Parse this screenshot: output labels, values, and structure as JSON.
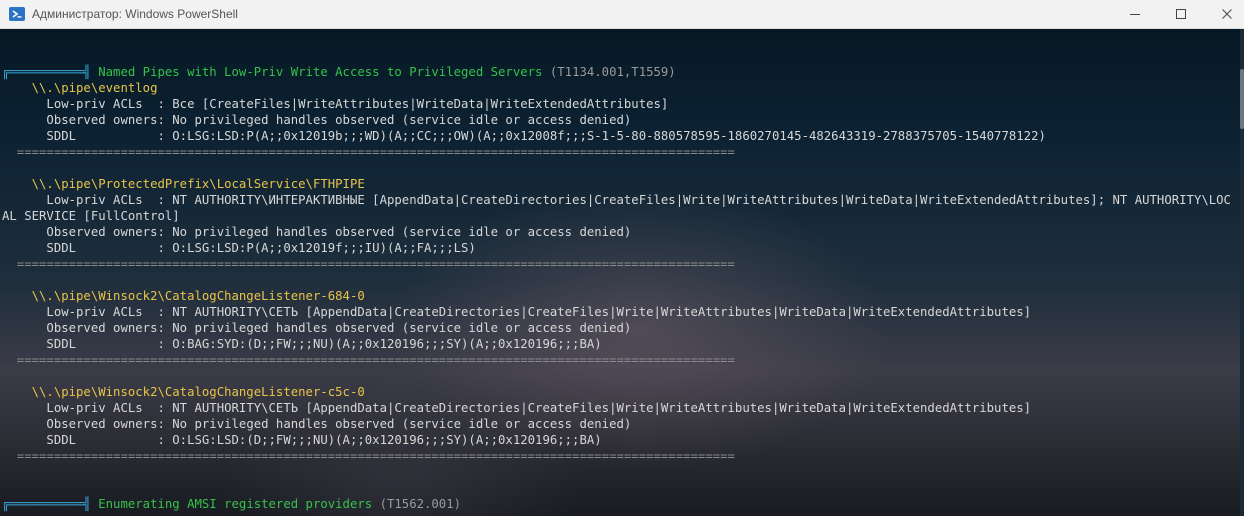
{
  "window": {
    "title": "Администратор: Windows PowerShell",
    "icon": "powershell-icon",
    "controls": [
      "minimize-icon",
      "maximize-icon",
      "close-icon"
    ]
  },
  "colors": {
    "header_branch": "#3aa9d8",
    "header_title": "#35c24a",
    "pipe_name": "#e8c449",
    "technique_ids": "#9a9a9a",
    "text": "#d7d7d7"
  },
  "console": {
    "separator": "  =================================================================================================",
    "sections": [
      {
        "branch": "╔══════════╣",
        "title": " Named Pipes with Low-Priv Write Access to Privileged Servers",
        "ids": " (T1134.001,T1559)",
        "pipes": [
          {
            "name": "    \\\\.\\pipe\\eventlog",
            "acl_label": "      Low-priv ACLs  : ",
            "acl_value": "Все [CreateFiles|WriteAttributes|WriteData|WriteExtendedAttributes]",
            "owners_label": "      Observed owners: ",
            "owners_value": "No privileged handles observed (service idle or access denied)",
            "sddl_label": "      SDDL           : ",
            "sddl_value": "O:LSG:LSD:P(A;;0x12019b;;;WD)(A;;CC;;;OW)(A;;0x12008f;;;S-1-5-80-880578595-1860270145-482643319-2788375705-1540778122)"
          },
          {
            "name": "    \\\\.\\pipe\\ProtectedPrefix\\LocalService\\FTHPIPE",
            "acl_label": "      Low-priv ACLs  : ",
            "acl_value": "NT AUTHORITY\\ИНТЕРАКТИВНЫЕ [AppendData|CreateDirectories|CreateFiles|Write|WriteAttributes|WriteData|WriteExtendedAttributes]; NT AUTHORITY\\LOCAL SERVICE [FullControl]",
            "owners_label": "      Observed owners: ",
            "owners_value": "No privileged handles observed (service idle or access denied)",
            "sddl_label": "      SDDL           : ",
            "sddl_value": "O:LSG:LSD:P(A;;0x12019f;;;IU)(A;;FA;;;LS)"
          },
          {
            "name": "    \\\\.\\pipe\\Winsock2\\CatalogChangeListener-684-0",
            "acl_label": "      Low-priv ACLs  : ",
            "acl_value": "NT AUTHORITY\\СЕТЬ [AppendData|CreateDirectories|CreateFiles|Write|WriteAttributes|WriteData|WriteExtendedAttributes]",
            "owners_label": "      Observed owners: ",
            "owners_value": "No privileged handles observed (service idle or access denied)",
            "sddl_label": "      SDDL           : ",
            "sddl_value": "O:BAG:SYD:(D;;FW;;;NU)(A;;0x120196;;;SY)(A;;0x120196;;;BA)"
          },
          {
            "name": "    \\\\.\\pipe\\Winsock2\\CatalogChangeListener-c5c-0",
            "acl_label": "      Low-priv ACLs  : ",
            "acl_value": "NT AUTHORITY\\СЕТЬ [AppendData|CreateDirectories|CreateFiles|Write|WriteAttributes|WriteData|WriteExtendedAttributes]",
            "owners_label": "      Observed owners: ",
            "owners_value": "No privileged handles observed (service idle or access denied)",
            "sddl_label": "      SDDL           : ",
            "sddl_value": "O:LSG:LSD:(D;;FW;;;NU)(A;;0x120196;;;SY)(A;;0x120196;;;BA)"
          }
        ]
      },
      {
        "branch": "╔══════════╣",
        "title": " Enumerating AMSI registered providers",
        "ids": " (T1562.001)"
      }
    ]
  }
}
